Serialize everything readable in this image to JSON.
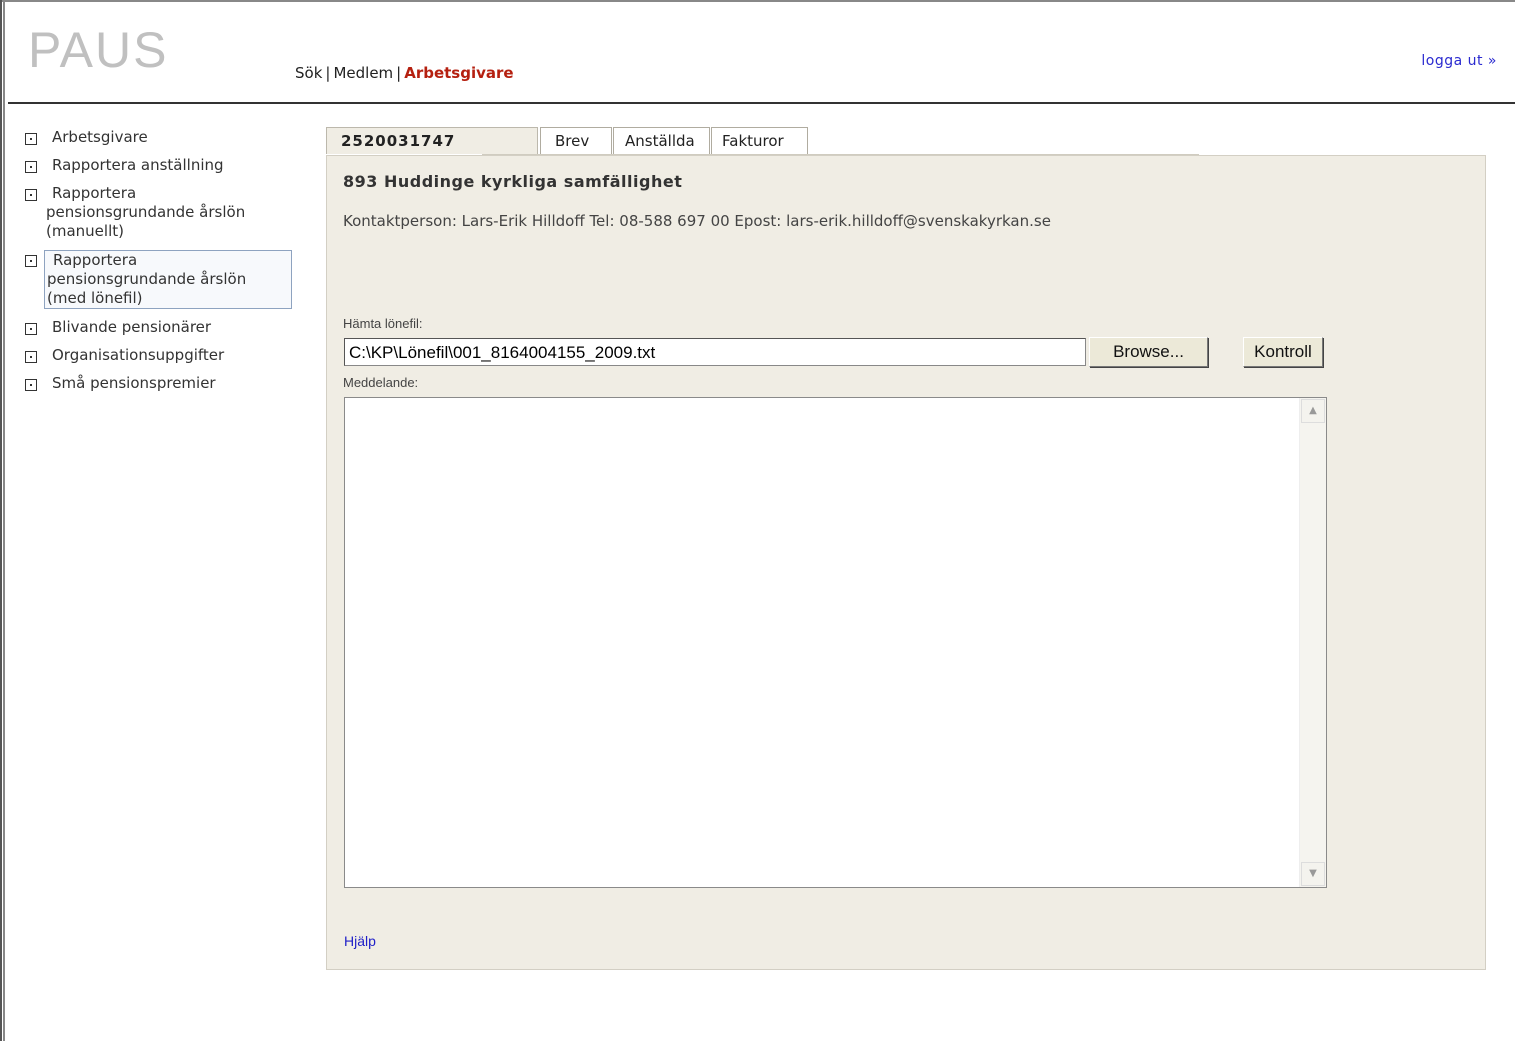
{
  "app": {
    "logo": "PAUS"
  },
  "topnav": {
    "items": [
      {
        "label": "Sök"
      },
      {
        "label": "Medlem"
      },
      {
        "label": "Arbetsgivare"
      }
    ],
    "separator": "|"
  },
  "logout": {
    "label": "logga ut »"
  },
  "sidebar": {
    "items": [
      {
        "label": "Arbetsgivare"
      },
      {
        "label": "Rapportera anställning"
      },
      {
        "lines": [
          "Rapportera",
          "pensionsgrundande årslön",
          "(manuellt)"
        ]
      },
      {
        "lines": [
          "Rapportera",
          "pensionsgrundande årslön",
          "(med lönefil)"
        ]
      },
      {
        "label": "Blivande pensionärer"
      },
      {
        "label": "Organisationsuppgifter"
      },
      {
        "label": "Små pensionspremier"
      }
    ]
  },
  "tabs": [
    {
      "label": "2520031747"
    },
    {
      "label": "Brev"
    },
    {
      "label": "Anställda"
    },
    {
      "label": "Fakturor"
    }
  ],
  "panel": {
    "org_title": "893 Huddinge kyrkliga samfällighet",
    "contact": "Kontaktperson: Lars-Erik Hilldoff Tel: 08-588 697 00 Epost: lars-erik.hilldoff@svenskakyrkan.se",
    "file_label": "Hämta lönefil:",
    "file_value": "C:\\KP\\Lönefil\\001_8164004155_2009.txt",
    "browse_label": "Browse...",
    "kontroll_label": "Kontroll",
    "message_label": "Meddelande:",
    "help_label": "Hjälp"
  },
  "colors": {
    "active_nav": "#b52010",
    "link": "#2020c8",
    "panel_bg": "#f0ede4"
  }
}
